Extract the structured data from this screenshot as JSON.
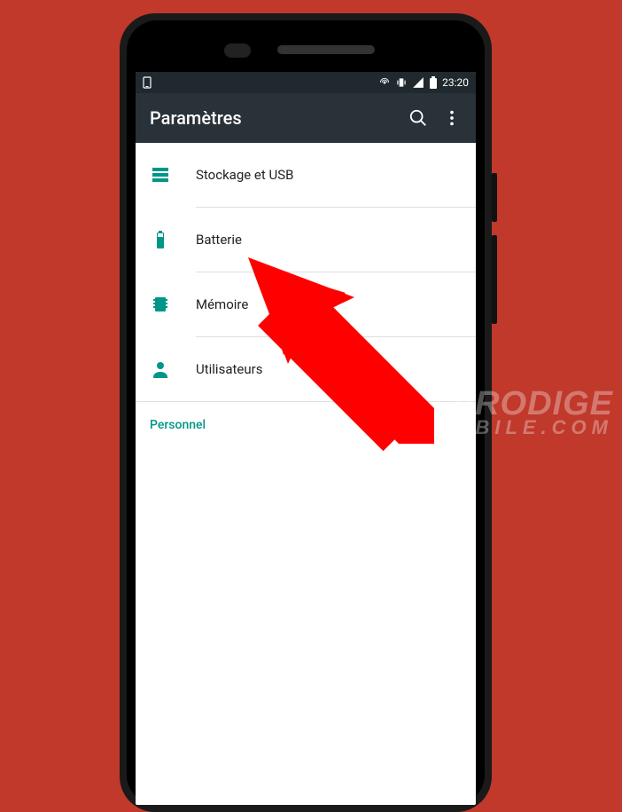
{
  "status_bar": {
    "time": "23:20"
  },
  "app_bar": {
    "title": "Paramètres"
  },
  "list": {
    "items": [
      {
        "label": "Stockage et USB"
      },
      {
        "label": "Batterie"
      },
      {
        "label": "Mémoire"
      },
      {
        "label": "Utilisateurs"
      }
    ]
  },
  "section": {
    "header": "Personnel"
  },
  "watermark": {
    "line1": "PRODIGE",
    "line2": "MOBILE.COM"
  },
  "colors": {
    "accent": "#009688",
    "appbar": "#283238",
    "statusbar": "#1f292e",
    "arrow": "#ff0000",
    "background": "#c0392b"
  }
}
